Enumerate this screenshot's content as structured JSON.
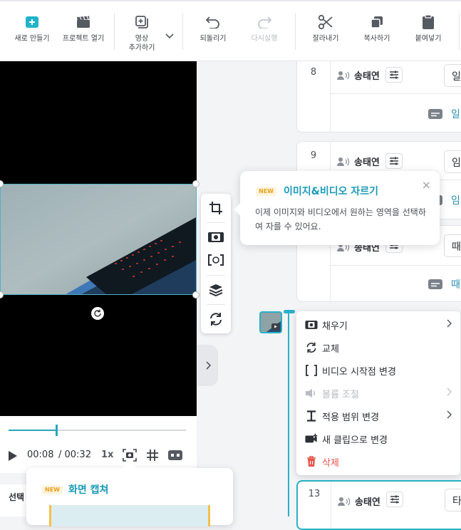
{
  "toolbar": {
    "new_project": "새로 만들기",
    "open_project": "프로젝트 열기",
    "add_video_line1": "영상",
    "add_video_line2": "추가하기",
    "undo": "되돌리기",
    "redo": "다시실행",
    "cut": "잘라내기",
    "copy": "복사하기",
    "paste": "붙여넣기"
  },
  "playback": {
    "current_time": "00:08",
    "total_time": "/ 00:32",
    "speed": "1x",
    "progress_fraction": 0.27
  },
  "capture_tip": {
    "badge": "NEW",
    "title": "화면 캡쳐"
  },
  "select_label": "선택",
  "crop_tip": {
    "badge": "NEW",
    "title": "이미지&비디오 자르기",
    "description": "이제 이미지와 비디오에서 원하는 영역을 선택하여 자를 수 있어요.",
    "close": "×"
  },
  "cards": [
    {
      "num": "8",
      "speaker": "송태연",
      "text": "일",
      "sub": "일"
    },
    {
      "num": "9",
      "speaker": "송태연",
      "text": "임",
      "sub": "임"
    },
    {
      "num": "",
      "speaker": "송태연",
      "text": "때",
      "sub": "때"
    },
    {
      "num": "13",
      "speaker": "송태연",
      "text": "타"
    }
  ],
  "context_menu": {
    "fill": "채우기",
    "replace": "교체",
    "video_start": "비디오 시작점 변경",
    "volume": "볼륨 조절",
    "range": "적용 범위 변경",
    "new_clip": "새 클립으로 변경",
    "delete": "삭제"
  },
  "colors": {
    "accent": "#28b1c9",
    "link": "#2a8fb5",
    "danger": "#e6534b",
    "badge": "#e8a020"
  }
}
